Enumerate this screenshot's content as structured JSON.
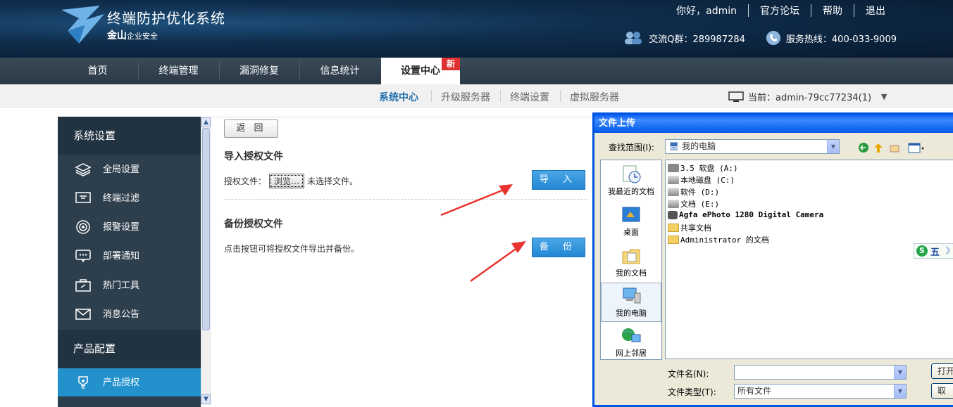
{
  "header": {
    "title": "终端防护优化系统",
    "brand": "金山",
    "brand_small": "企业安全",
    "greeting": "你好，admin",
    "links": [
      "官方论坛",
      "帮助",
      "退出"
    ],
    "qq_group": "交流Q群：289987284",
    "hotline": "服务热线：400-033-9009"
  },
  "nav": {
    "items": [
      "首页",
      "终端管理",
      "漏洞修复",
      "信息统计",
      "设置中心"
    ],
    "badge": "新"
  },
  "subnav": {
    "items": [
      "系统中心",
      "升级服务器",
      "终端设置",
      "虚拟服务器"
    ],
    "current": "当前：admin-79cc77234(1)"
  },
  "sidebar": {
    "section1": "系统设置",
    "items": [
      "全局设置",
      "终端过滤",
      "报警设置",
      "部署通知",
      "热门工具",
      "消息公告"
    ],
    "section2": "产品配置",
    "active_item": "产品授权"
  },
  "content": {
    "back": "返 回",
    "import_title": "导入授权文件",
    "import_label": "授权文件：",
    "browse": "浏览…",
    "no_file": "未选择文件。",
    "import_btn": "导 入",
    "backup_title": "备份授权文件",
    "backup_text": "点击按钮可将授权文件导出并备份。",
    "backup_btn": "备 份"
  },
  "dialog": {
    "title": "文件上传",
    "lookin_label": "查找范围(I):",
    "lookin_value": "我的电脑",
    "places": [
      "我最近的文档",
      "桌面",
      "我的文档",
      "我的电脑",
      "网上邻居"
    ],
    "files": [
      "3.5 软盘 (A:)",
      "本地磁盘 (C:)",
      "软件 (D:)",
      "文档 (E:)",
      "Agfa ePhoto 1280 Digital Camera",
      "共享文档",
      "Administrator 的文档"
    ],
    "filename_label": "文件名(N):",
    "filetype_label": "文件类型(T):",
    "filetype_value": "所有文件",
    "open_btn": "打开",
    "cancel_btn": "取"
  },
  "ime": {
    "label": "五"
  }
}
